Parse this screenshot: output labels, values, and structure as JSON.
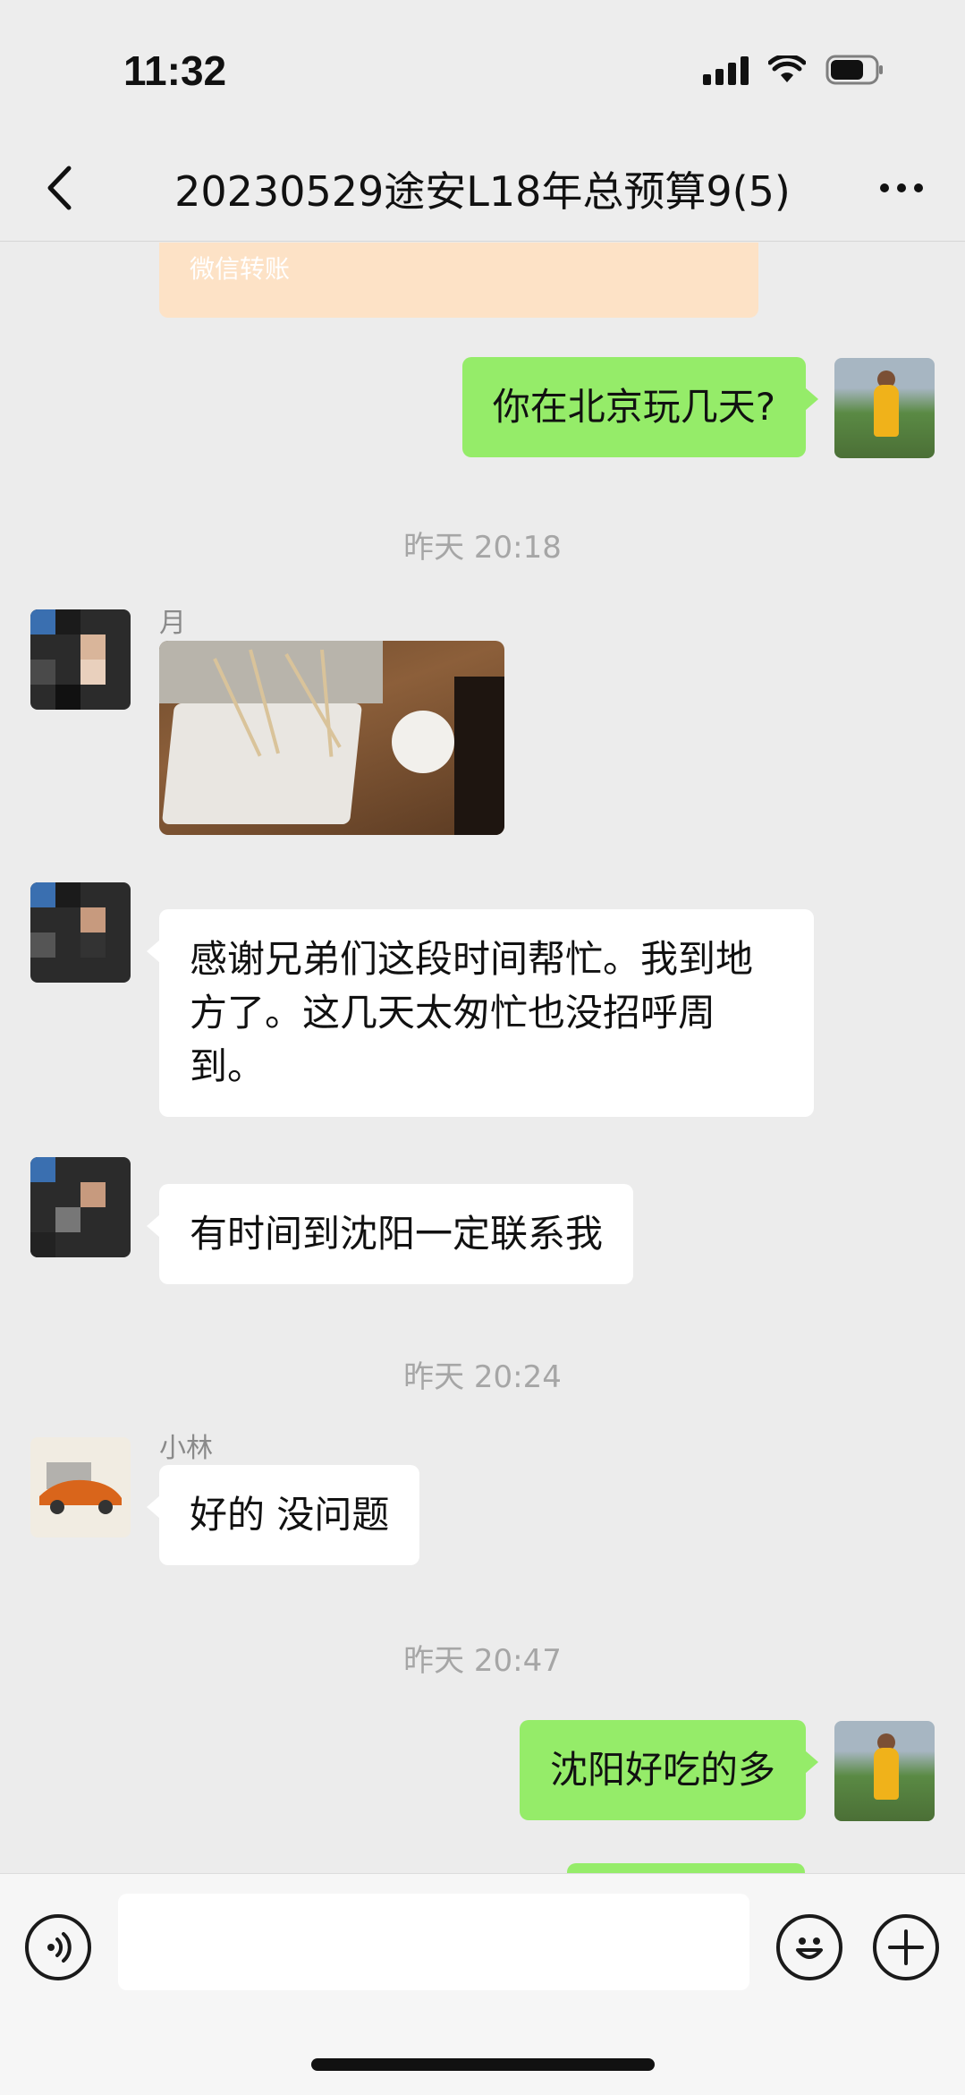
{
  "status_bar": {
    "time": "11:32"
  },
  "nav": {
    "title": "20230529途安L18年总预算9(5)"
  },
  "chat": {
    "transfer_label": "微信转账",
    "messages": [
      {
        "text": "你在北京玩几天?"
      },
      {
        "time": "昨天 20:18"
      },
      {
        "sender": "月"
      },
      {
        "text": "感谢兄弟们这段时间帮忙。我到地方了。这几天太匆忙也没招呼周到。"
      },
      {
        "text": "有时间到沈阳一定联系我"
      },
      {
        "time": "昨天 20:24"
      },
      {
        "sender": "小林"
      },
      {
        "text": "好的 没问题"
      },
      {
        "time": "昨天 20:47"
      },
      {
        "text": "沈阳好吃的多"
      }
    ]
  },
  "input_bar": {
    "placeholder": ""
  }
}
